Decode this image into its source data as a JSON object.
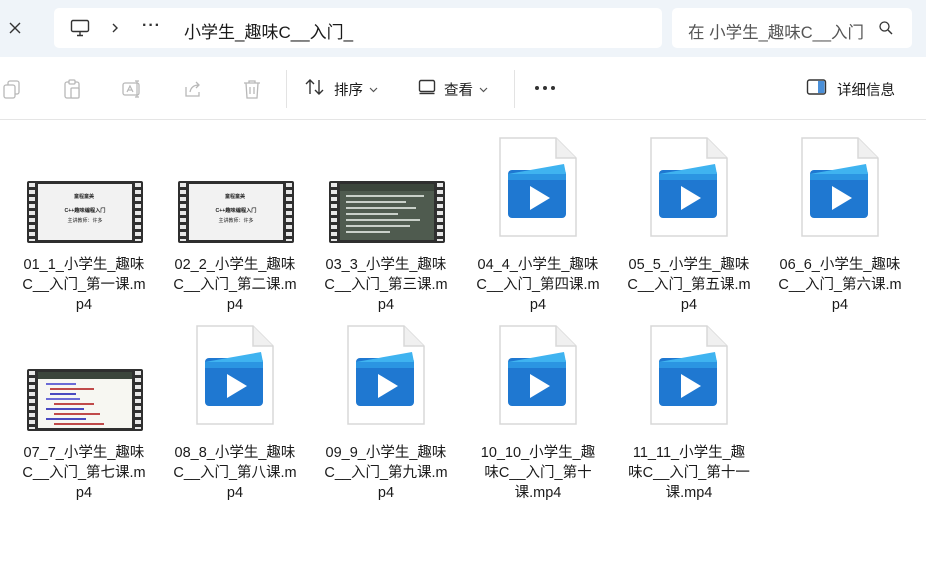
{
  "address_bar": {
    "close_icon": "close-icon",
    "path_icon": "computer-icon",
    "overflow": "···",
    "current_folder": "小学生_趣味C__入门_",
    "search_placeholder": "在 小学生_趣味C__入门_ 中搜索"
  },
  "toolbar": {
    "sort_label": "排序",
    "view_label": "查看",
    "more_label": "···",
    "details_label": "详细信息"
  },
  "files": [
    {
      "name": "01_1_小学生_趣味C__入门_第一课.mp4",
      "thumb": "video-light"
    },
    {
      "name": "02_2_小学生_趣味C__入门_第二课.mp4",
      "thumb": "video-light"
    },
    {
      "name": "03_3_小学生_趣味C__入门_第三课.mp4",
      "thumb": "video-dark"
    },
    {
      "name": "04_4_小学生_趣味C__入门_第四课.mp4",
      "thumb": "media-icon"
    },
    {
      "name": "05_5_小学生_趣味C__入门_第五课.mp4",
      "thumb": "media-icon"
    },
    {
      "name": "06_6_小学生_趣味C__入门_第六课.mp4",
      "thumb": "media-icon"
    },
    {
      "name": "07_7_小学生_趣味C__入门_第七课.mp4",
      "thumb": "video-code"
    },
    {
      "name": "08_8_小学生_趣味C__入门_第八课.mp4",
      "thumb": "media-icon"
    },
    {
      "name": "09_9_小学生_趣味C__入门_第九课.mp4",
      "thumb": "media-icon"
    },
    {
      "name": "10_10_小学生_趣味C__入门_第十课.mp4",
      "thumb": "media-icon"
    },
    {
      "name": "11_11_小学生_趣味C__入门_第十一课.mp4",
      "thumb": "media-icon"
    }
  ],
  "thumbnail_text": {
    "logo": "童程童美",
    "title": "C++趣味编程入门",
    "teacher": "主讲教师：许多"
  },
  "colors": {
    "address_bg": "#eff4f9",
    "media_blue": "#1f78d1",
    "media_light": "#3fb3f0"
  }
}
